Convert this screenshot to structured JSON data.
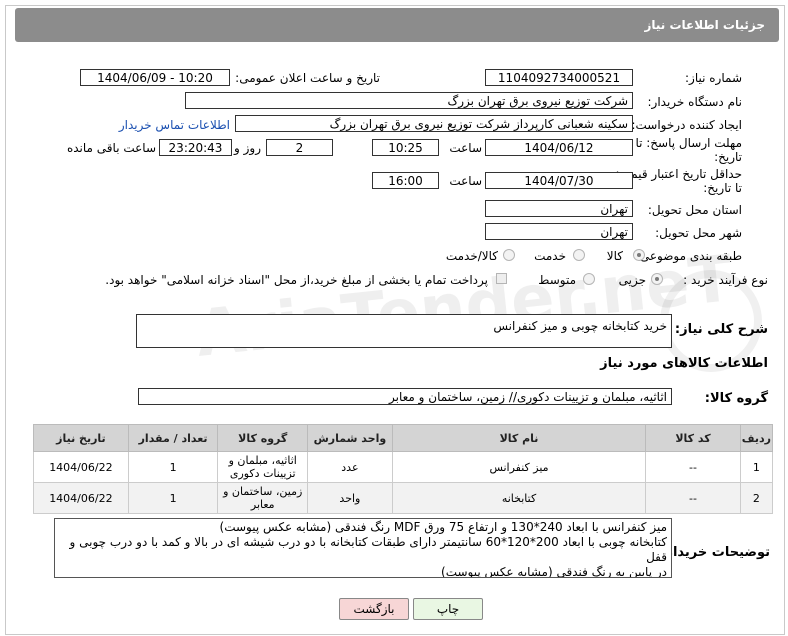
{
  "header": {
    "title": "جزئیات اطلاعات نیاز"
  },
  "watermark": "AriaTender.neT",
  "fields": {
    "need_number_label": "شماره نیاز:",
    "need_number": "1104092734000521",
    "announce_label": "تاریخ و ساعت اعلان عمومی:",
    "announce_value": "1404/06/09 - 10:20",
    "buyer_label": "نام دستگاه خریدار:",
    "buyer_value": "شرکت توزیع نیروی برق تهران بزرگ",
    "creator_label": "ایجاد کننده درخواست:",
    "creator_value": "سکینه شعبانی کارپرداز شرکت توزیع نیروی برق تهران بزرگ",
    "contact_link": "اطلاعات تماس خریدار",
    "reply_label_1": "مهلت ارسال پاسخ: تا",
    "reply_label_2": "تاریخ:",
    "reply_date": "1404/06/12",
    "time_label": "ساعت",
    "reply_time": "10:25",
    "days_value": "2",
    "days_label": "روز و",
    "remaining_value": "23:20:43",
    "remaining_label": "ساعت باقی مانده",
    "price_label_1": "حداقل تاریخ اعتبار قیمت:",
    "price_label_2": "تا تاریخ:",
    "price_date": "1404/07/30",
    "price_time": "16:00",
    "province_label": "استان محل تحویل:",
    "province_value": "تهران",
    "city_label": "شهر محل تحویل:",
    "city_value": "تهران",
    "category_label": "طبقه بندی موضوعی:",
    "cat_goods": "کالا",
    "cat_service": "خدمت",
    "cat_both": "کالا/خدمت",
    "process_label": "نوع فرآیند خرید :",
    "proc_minor": "جزیی",
    "proc_medium": "متوسط",
    "payment_note": "پرداخت تمام یا بخشی از مبلغ خرید،از محل \"اسناد خزانه اسلامی\" خواهد بود.",
    "summary_label": "شرح کلی نیاز:",
    "summary_value": "خرید کتابخانه چوبی و میز کنفرانس",
    "goods_info_title": "اطلاعات کالاهای مورد نیاز",
    "goods_group_label": "گروه کالا:",
    "goods_group_value": "اثاثیه، مبلمان و تزیینات دکوری// زمین، ساختمان و معابر"
  },
  "table": {
    "headers": [
      "ردیف",
      "کد کالا",
      "نام کالا",
      "واحد شمارش",
      "گروه کالا",
      "تعداد / مقدار",
      "تاریخ نیاز"
    ],
    "rows": [
      {
        "idx": "1",
        "code": "--",
        "name": "میز کنفرانس",
        "unit": "عدد",
        "group": "اثاثیه، مبلمان و تزیینات دکوری",
        "qty": "1",
        "date": "1404/06/22"
      },
      {
        "idx": "2",
        "code": "--",
        "name": "کتابخانه",
        "unit": "واحد",
        "group": "زمین، ساختمان و معابر",
        "qty": "1",
        "date": "1404/06/22"
      }
    ]
  },
  "buyer_notes": {
    "label": "توضیحات خریدار:",
    "line1": "میز کنفرانس با ابعاد 240*130 و ارتفاع 75 ورق MDF رنگ فندقی (مشابه عکس پیوست)",
    "line2": "کتابخانه چوبی با ابعاد 200*120*60 سانتیمتر دارای طبقات کتابخانه با دو درب شیشه ای در بالا و کمد با دو درب چوبی و قفل",
    "line3": "در پایین به رنگ فندقی (مشابه عکس پیوست)"
  },
  "buttons": {
    "print": "چاپ",
    "back": "بازگشت"
  },
  "colors": {
    "header": "#8c8c8c",
    "back_button": "#f7d6d6",
    "print_button": "#e9f7e3"
  }
}
